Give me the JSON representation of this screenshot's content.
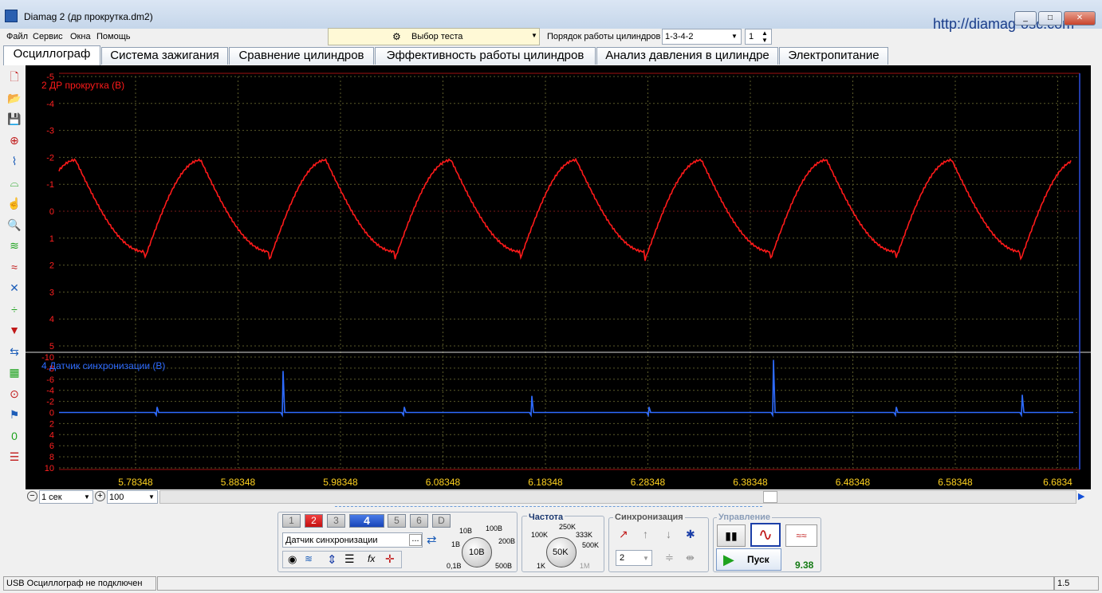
{
  "window": {
    "title": "Diamag 2 (др прокрутка.dm2)",
    "url": "http://diamag-osc.com",
    "min_glyph": "_",
    "max_glyph": "□",
    "close_glyph": "✕"
  },
  "menu": [
    "Файл",
    "Сервис",
    "Окна",
    "Помощь"
  ],
  "test_select": {
    "label": "Выбор теста"
  },
  "cylinder_order": {
    "label": "Порядок работы цилиндров",
    "value": "1-3-4-2",
    "count": "1"
  },
  "tabs": [
    "Осциллограф",
    "Система зажигания",
    "Сравнение цилиндров",
    "Эффективность работы цилиндров",
    "Анализ давления в цилиндре",
    "Электропитание"
  ],
  "active_tab": 0,
  "tools": [
    "new-file-icon",
    "open-folder-icon",
    "save-icon",
    "auto-scale-icon",
    "measure-icon",
    "cursor-icon",
    "hand-icon",
    "zoom-icon",
    "wave-filter-icon",
    "wave-compare-icon",
    "wave-invert-icon",
    "level-icon",
    "filter-icon",
    "channel-move-icon",
    "table-icon",
    "auto-timer-icon",
    "flag-icon",
    "zero-icon",
    "report-icon"
  ],
  "channel2": {
    "label": "2 ДР прокрутка (В)",
    "color": "#ff1a1a",
    "ticks": [
      "-5",
      "-4",
      "-3",
      "-2",
      "-1",
      "0",
      "1",
      "2",
      "3",
      "4",
      "5"
    ]
  },
  "channel4": {
    "label": "4 Датчик синхронизации (В)",
    "color": "#2e6bff",
    "ticks": [
      "-10",
      "-8",
      "-6",
      "-4",
      "-2",
      "0",
      "2",
      "4",
      "6",
      "8",
      "10"
    ]
  },
  "time_axis": [
    "5.78348",
    "5.88348",
    "5.98348",
    "6.08348",
    "6.18348",
    "6.28348",
    "6.38348",
    "6.48348",
    "6.58348",
    "6.6834"
  ],
  "timebase": {
    "value": "1 сек",
    "zoom": "100"
  },
  "channels": {
    "buttons": [
      "1",
      "2",
      "3",
      "4",
      "5",
      "6",
      "D"
    ],
    "active": "4",
    "red": "2"
  },
  "sensor": {
    "value": "Датчик синхронизации",
    "browse": "..."
  },
  "volt_knob": {
    "center": "10В",
    "labels": [
      "0,1В",
      "1В",
      "10В",
      "100В",
      "200В",
      "500В"
    ]
  },
  "freq": {
    "title": "Частота",
    "center": "50K",
    "labels": [
      "1K",
      "100K",
      "250K",
      "333K",
      "500K",
      "1M"
    ]
  },
  "sync": {
    "title": "Синхронизация",
    "channel": "2"
  },
  "control": {
    "title": "Управление",
    "start": "Пуск",
    "value": "9.38"
  },
  "status": {
    "left": "USB Осциллограф не подключен",
    "right": "1.5"
  }
}
